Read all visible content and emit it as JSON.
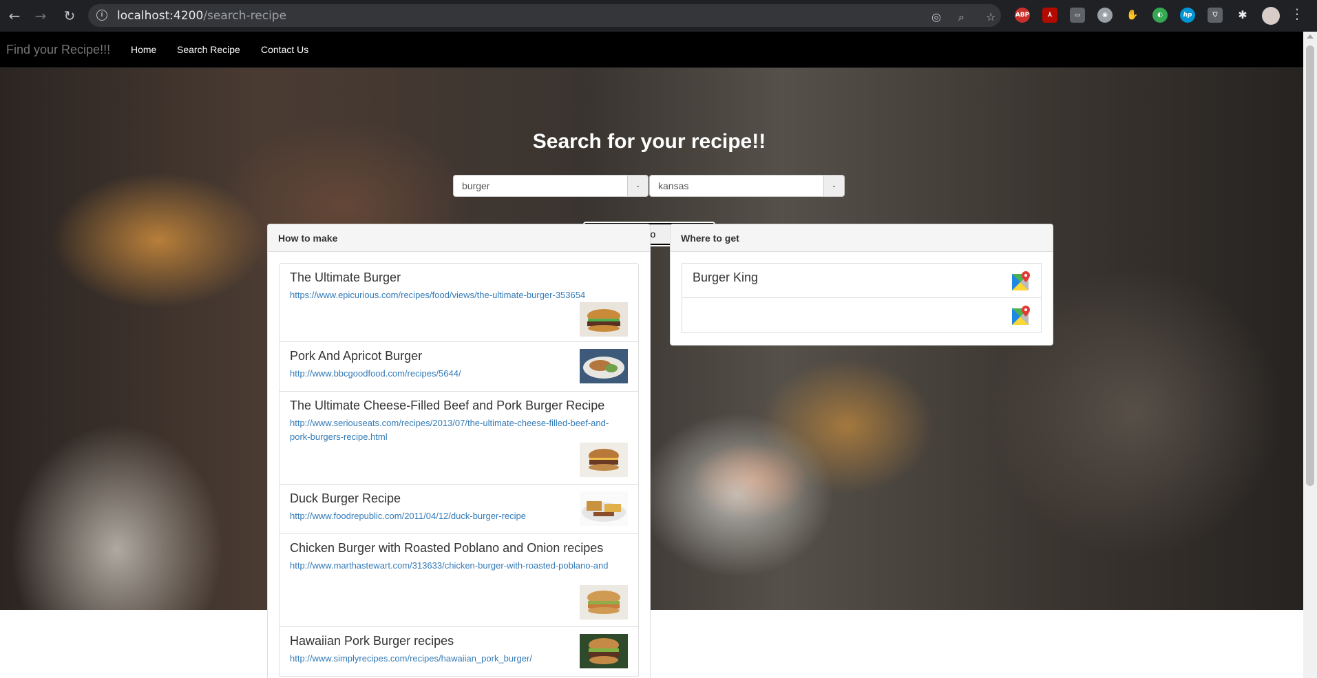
{
  "browser": {
    "url_host": "localhost:4200",
    "url_path": "/search-recipe"
  },
  "navbar": {
    "brand": "Find your Recipe!!!",
    "links": [
      "Home",
      "Search Recipe",
      "Contact Us"
    ]
  },
  "hero": {
    "title": "Search for your recipe!!"
  },
  "search": {
    "food_value": "burger",
    "food_addon": "-",
    "location_value": "kansas",
    "location_addon": "-",
    "go_label": "Go"
  },
  "how_to_make": {
    "heading": "How to make",
    "recipes": [
      {
        "title": "The Ultimate Burger",
        "url": "https://www.epicurious.com/recipes/food/views/the-ultimate-burger-353654"
      },
      {
        "title": "Pork And Apricot Burger",
        "url": "http://www.bbcgoodfood.com/recipes/5644/"
      },
      {
        "title": "The Ultimate Cheese-Filled Beef and Pork Burger Recipe",
        "url": "http://www.seriouseats.com/recipes/2013/07/the-ultimate-cheese-filled-beef-and-pork-burgers-recipe.html"
      },
      {
        "title": "Duck Burger Recipe",
        "url": "http://www.foodrepublic.com/2011/04/12/duck-burger-recipe"
      },
      {
        "title": "Chicken Burger with Roasted Poblano and Onion recipes",
        "url": "http://www.marthastewart.com/313633/chicken-burger-with-roasted-poblano-and"
      },
      {
        "title": "Hawaiian Pork Burger recipes",
        "url": "http://www.simplyrecipes.com/recipes/hawaiian_pork_burger/"
      }
    ]
  },
  "where_to_get": {
    "heading": "Where to get",
    "stores": [
      {
        "name": "Burger King"
      },
      {
        "name": ""
      }
    ]
  },
  "icons": {
    "map": "google-maps-icon",
    "thumb": "burger-photo"
  }
}
